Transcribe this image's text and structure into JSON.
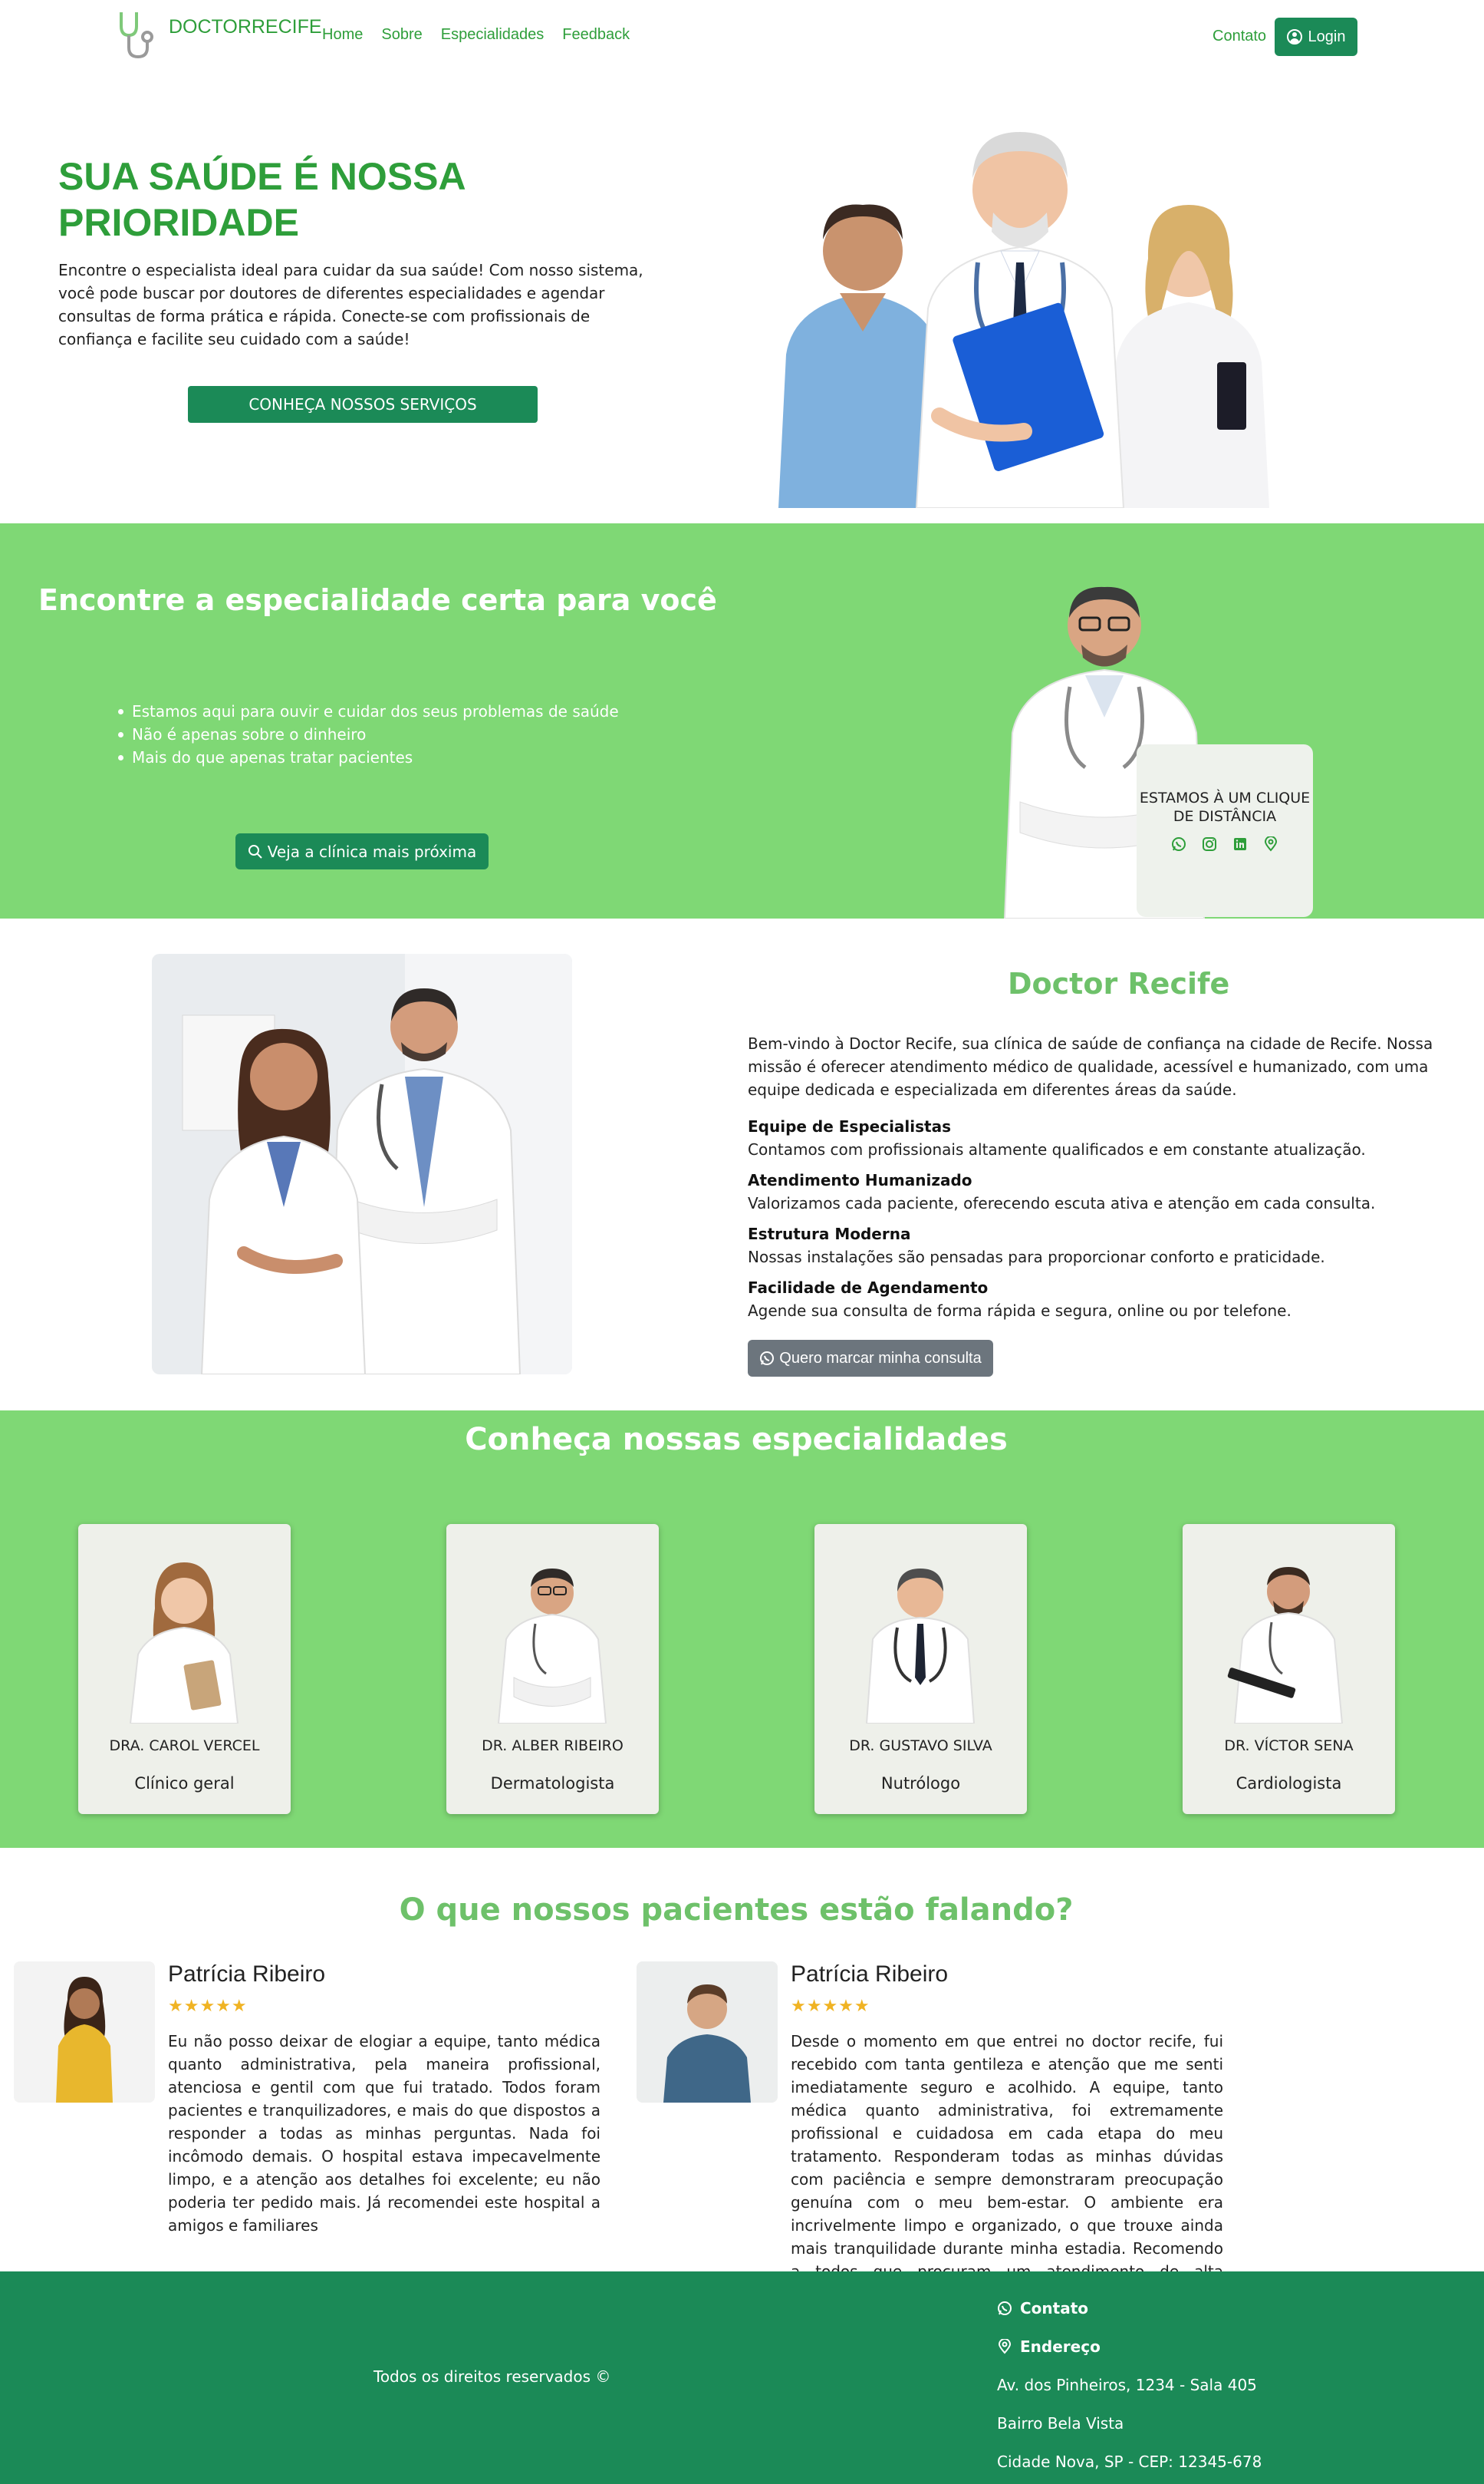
{
  "nav": {
    "brand": "DOCTORRECIFE",
    "links": [
      "Home",
      "Sobre",
      "Especialidades",
      "Feedback"
    ],
    "contato": "Contato",
    "login": "Login"
  },
  "hero": {
    "title": "SUA SAÚDE É NOSSA PRIORIDADE",
    "text": "Encontre o especialista ideal para cuidar da sua saúde! Com nosso sistema, você pode buscar por doutores de diferentes especialidades e agendar consultas de forma prática e rápida. Conecte-se com profissionais de confiança e facilite seu cuidado com a saúde!",
    "button": "CONHEÇA NOSSOS SERVIÇOS"
  },
  "banner": {
    "title": "Encontre a especialidade certa para você",
    "items": [
      "Estamos aqui para ouvir e cuidar dos seus problemas de saúde",
      "Não é apenas sobre o dinheiro",
      "Mais do que apenas tratar pacientes"
    ],
    "button": "Veja a clínica mais próxima",
    "card_text": "ESTAMOS À UM CLIQUE DE DISTÂNCIA"
  },
  "about": {
    "title": "Doctor Recife",
    "intro": "Bem-vindo à Doctor Recife, sua clínica de saúde de confiança na cidade de Recife. Nossa missão é oferecer atendimento médico de qualidade, acessível e humanizado, com uma equipe dedicada e especializada em diferentes áreas da saúde.",
    "blocks": [
      {
        "heading": "Equipe de Especialistas",
        "text": "Contamos com profissionais altamente qualificados e em constante atualização."
      },
      {
        "heading": "Atendimento Humanizado",
        "text": "Valorizamos cada paciente, oferecendo escuta ativa e atenção em cada consulta."
      },
      {
        "heading": "Estrutura Moderna",
        "text": "Nossas instalações são pensadas para proporcionar conforto e praticidade."
      },
      {
        "heading": "Facilidade de Agendamento",
        "text": "Agende sua consulta de forma rápida e segura, online ou por telefone."
      }
    ],
    "button": "Quero marcar minha consulta"
  },
  "specialties": {
    "title": "Conheça nossas especialidades",
    "cards": [
      {
        "name": "DRA. CAROL VERCEL",
        "role": "Clínico geral"
      },
      {
        "name": "DR. ALBER RIBEIRO",
        "role": "Dermatologista"
      },
      {
        "name": "DR. GUSTAVO SILVA",
        "role": "Nutrólogo"
      },
      {
        "name": "DR. VÍCTOR SENA",
        "role": "Cardiologista"
      }
    ]
  },
  "testimonials": {
    "title": "O que nossos pacientes estão falando?",
    "items": [
      {
        "name": "Patrícia Ribeiro",
        "stars": "★★★★★",
        "text": "Eu não posso deixar de elogiar a equipe, tanto médica quanto administrativa, pela maneira profissional, atenciosa e gentil com que fui tratado. Todos foram pacientes e tranquilizadores, e mais do que dispostos a responder a todas as minhas perguntas. Nada foi incômodo demais. O hospital estava impecavelmente limpo, e a atenção aos detalhes foi excelente; eu não poderia ter pedido mais. Já recomendei este hospital a amigos e familiares"
      },
      {
        "name": "Patrícia Ribeiro",
        "stars": "★★★★★",
        "text": "Desde o momento em que entrei no doctor recife, fui recebido com tanta gentileza e atenção que me senti imediatamente seguro e acolhido. A equipe, tanto médica quanto administrativa, foi extremamente profissional e cuidadosa em cada etapa do meu tratamento. Responderam todas as minhas dúvidas com paciência e sempre demonstraram preocupação genuína com o meu bem-estar. O ambiente era incrivelmente limpo e organizado, o que trouxe ainda mais tranquilidade durante minha estadia. Recomendo a todos que procuram um atendimento de alta qualidade e humanizado"
      }
    ]
  },
  "footer": {
    "rights": "Todos os direitos reservados ©",
    "contato": "Contato",
    "endereco": "Endereço",
    "address_line1": "Av. dos Pinheiros, 1234 - Sala 405",
    "address_line2": "Bairro Bela Vista",
    "address_line3": "Cidade Nova, SP - CEP: 12345-678"
  },
  "colors": {
    "brand_green": "#2e9e3a",
    "band_green": "#7fd875",
    "dark_green": "#1b8a57",
    "gray_button": "#6c757d"
  }
}
